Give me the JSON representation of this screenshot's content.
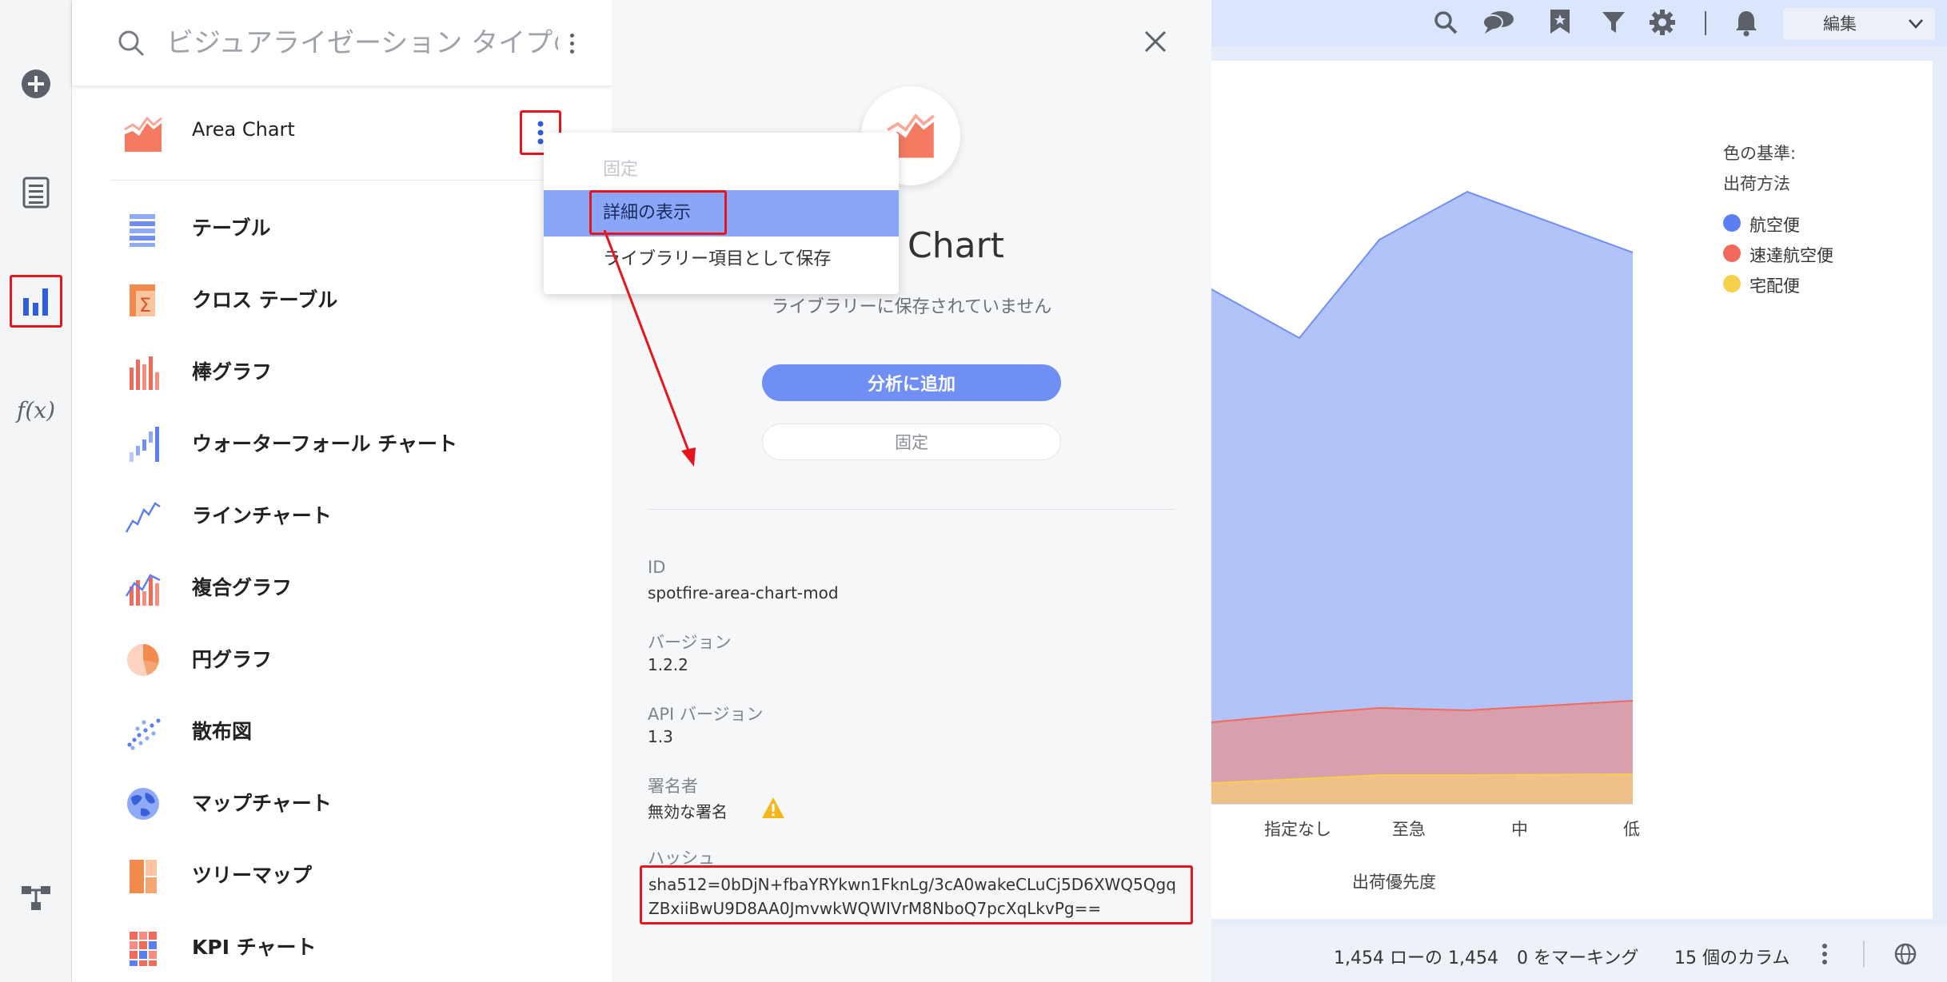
{
  "search": {
    "placeholder": "ビジュアライゼーション タイプの検索"
  },
  "vis_list": [
    {
      "label": "Area Chart",
      "icon": "area-chart-icon"
    },
    {
      "label": "テーブル",
      "icon": "table-icon"
    },
    {
      "label": "クロス テーブル",
      "icon": "cross-table-icon"
    },
    {
      "label": "棒グラフ",
      "icon": "bar-chart-icon"
    },
    {
      "label": "ウォーターフォール チャート",
      "icon": "waterfall-chart-icon"
    },
    {
      "label": "ラインチャート",
      "icon": "line-chart-icon"
    },
    {
      "label": "複合グラフ",
      "icon": "combination-chart-icon"
    },
    {
      "label": "円グラフ",
      "icon": "pie-chart-icon"
    },
    {
      "label": "散布図",
      "icon": "scatter-plot-icon"
    },
    {
      "label": "マップチャート",
      "icon": "map-chart-icon"
    },
    {
      "label": "ツリーマップ",
      "icon": "treemap-icon"
    },
    {
      "label": "KPI チャート",
      "icon": "kpi-chart-icon"
    }
  ],
  "menu": {
    "pin": "固定",
    "show_details": "詳細の表示",
    "save_to_library": "ライブラリー項目として保存"
  },
  "details": {
    "title": "Chart",
    "saved_status": "ライブラリーに保存されていません",
    "add_button": "分析に追加",
    "pin_button": "固定",
    "props": {
      "id_label": "ID",
      "id_value": "spotfire-area-chart-mod",
      "version_label": "バージョン",
      "version_value": "1.2.2",
      "api_version_label": "API バージョン",
      "api_version_value": "1.3",
      "signer_label": "署名者",
      "signer_value": "無効な署名",
      "hash_label": "ハッシュ",
      "hash_value": "sha512=0bDjN+fbaYRYkwn1FknLg/3cA0wakeCLuCj5D6XWQ5QgqZBxiiBwU9D8AA0JmvwkWQWIVrM8NboQ7pcXqLkvPg=="
    }
  },
  "toolbar": {
    "edit_label": "編集"
  },
  "legend": {
    "title1": "色の基準:",
    "title2": "出荷方法",
    "items": [
      {
        "label": "航空便",
        "color": "#5b7ff0"
      },
      {
        "label": "速達航空便",
        "color": "#f26a5b"
      },
      {
        "label": "宅配便",
        "color": "#f7d04b"
      }
    ]
  },
  "x_axis": {
    "ticks": [
      "指定なし",
      "至急",
      "中",
      "低"
    ],
    "title": "出荷優先度"
  },
  "status": {
    "rows": "1,454 ローの 1,454",
    "marked": "0 をマーキング",
    "columns": "15 個のカラム"
  },
  "colors": {
    "accent": "#6f8ff5",
    "highlight": "#e8141b",
    "menu_active": "#8aa6f8",
    "area_blue": "#b2c3f9",
    "area_red": "#d8a0ad",
    "area_yellow": "#f0c08a"
  }
}
